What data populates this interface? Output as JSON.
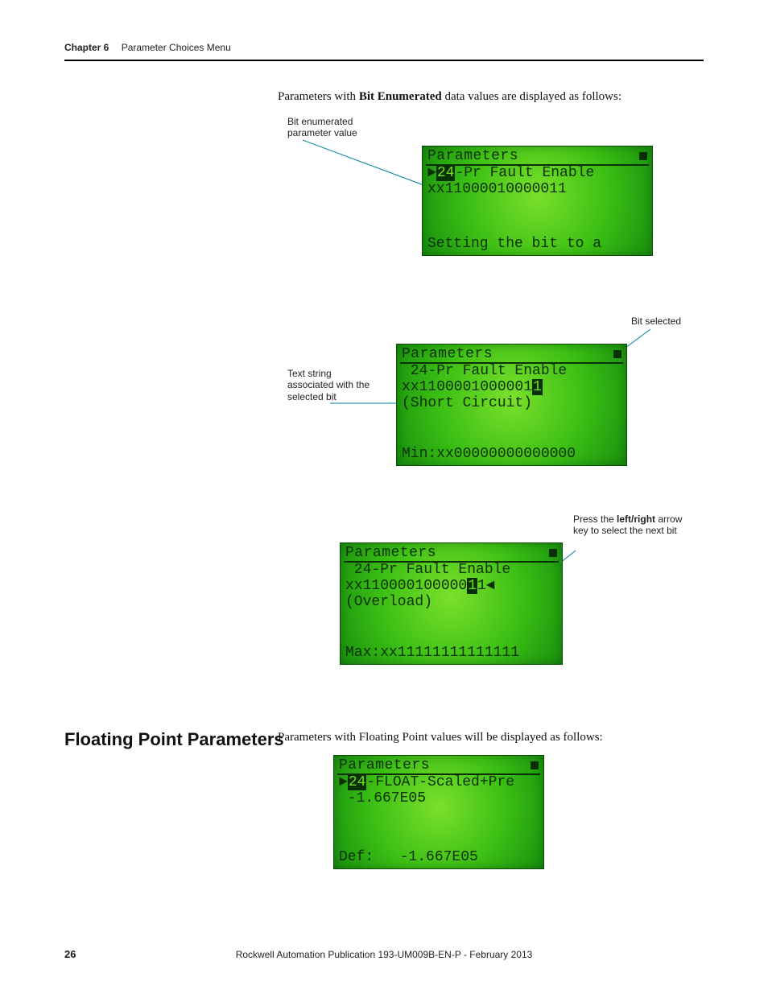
{
  "header": {
    "chapter": "Chapter 6",
    "title": "Parameter Choices Menu"
  },
  "intro1_pre": "Parameters with ",
  "intro1_bold": "Bit Enumerated",
  "intro1_post": " data values are displayed as follows:",
  "annot1": "Bit enumerated parameter value",
  "annot2": "Bit selected",
  "annot3": "Text string associated with the selected bit",
  "annot4_pre": "Press the ",
  "annot4_bold": "left/right",
  "annot4_post": " arrow key to select the next bit",
  "section_heading": "Floating Point Parameters",
  "intro2": "Parameters with Floating Point values will be displayed as follows:",
  "lcd1": {
    "title": "Parameters",
    "l1_inv": "24",
    "l1_rest": "-Pr Fault Enable",
    "l2": "xx11000010000011",
    "bottom": "Setting the bit to a"
  },
  "lcd2": {
    "title": "Parameters",
    "l1": " 24-Pr Fault Enable",
    "l2_pre": "xx1100001000001",
    "l2_inv": "1",
    "l3": "(Short Circuit)",
    "bottom": "Min:xx00000000000000"
  },
  "lcd3": {
    "title": "Parameters",
    "l1": " 24-Pr Fault Enable",
    "l2_pre": "xx110000100000",
    "l2_inv": "1",
    "l2_post": "1◄",
    "l3": "(Overload)",
    "bottom": "Max:xx11111111111111"
  },
  "lcd4": {
    "title": "Parameters",
    "l1_inv": "24",
    "l1_rest": "-FLOAT-Scaled+Pre",
    "l2": " -1.667E05",
    "bottom": "Def:   -1.667E05"
  },
  "footer": {
    "page": "26",
    "pub": "Rockwell Automation Publication 193-UM009B-EN-P - February 2013"
  }
}
